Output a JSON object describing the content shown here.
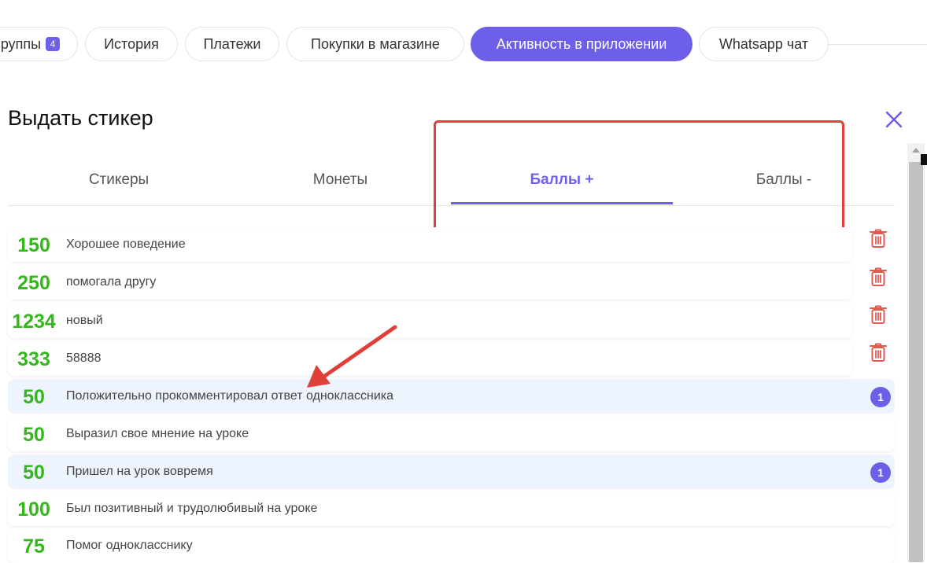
{
  "top_tabs": [
    {
      "label": "руппы",
      "badge": "4",
      "active": false
    },
    {
      "label": "История",
      "active": false
    },
    {
      "label": "Платежи",
      "active": false
    },
    {
      "label": "Покупки в магазине",
      "active": false
    },
    {
      "label": "Активность в приложении",
      "active": true
    },
    {
      "label": "Whatsapp чат",
      "active": false
    }
  ],
  "modal": {
    "title": "Выдать стикер",
    "close_icon": "close-icon",
    "tabs": [
      {
        "label": "Стикеры",
        "active": false
      },
      {
        "label": "Монеты",
        "active": false
      },
      {
        "label": "Баллы +",
        "active": true
      },
      {
        "label": "Баллы -",
        "active": false
      }
    ],
    "items": [
      {
        "value": "150",
        "label": "Хорошее поведение",
        "deletable": true,
        "selected": false,
        "count": null
      },
      {
        "value": "250",
        "label": "помогала другу",
        "deletable": true,
        "selected": false,
        "count": null
      },
      {
        "value": "1234",
        "label": "новый",
        "deletable": true,
        "selected": false,
        "count": null
      },
      {
        "value": "333",
        "label": "58888",
        "deletable": true,
        "selected": false,
        "count": null
      },
      {
        "value": "50",
        "label": "Положительно прокомментировал ответ одноклассника",
        "deletable": false,
        "selected": true,
        "count": "1"
      },
      {
        "value": "50",
        "label": "Выразил свое мнение на уроке",
        "deletable": false,
        "selected": false,
        "count": null
      },
      {
        "value": "50",
        "label": "Пришел на урок вовремя",
        "deletable": false,
        "selected": true,
        "count": "1"
      },
      {
        "value": "100",
        "label": "Был позитивный и трудолюбивый на уроке",
        "deletable": false,
        "selected": false,
        "count": null
      },
      {
        "value": "75",
        "label": "Помог однокласснику",
        "deletable": false,
        "selected": false,
        "count": null
      }
    ]
  },
  "colors": {
    "accent": "#6d5fe7",
    "points_green": "#34b61d",
    "delete_red": "#e05a4f",
    "annotation_red": "#e0403a",
    "selected_row_bg": "#eef4fd"
  }
}
